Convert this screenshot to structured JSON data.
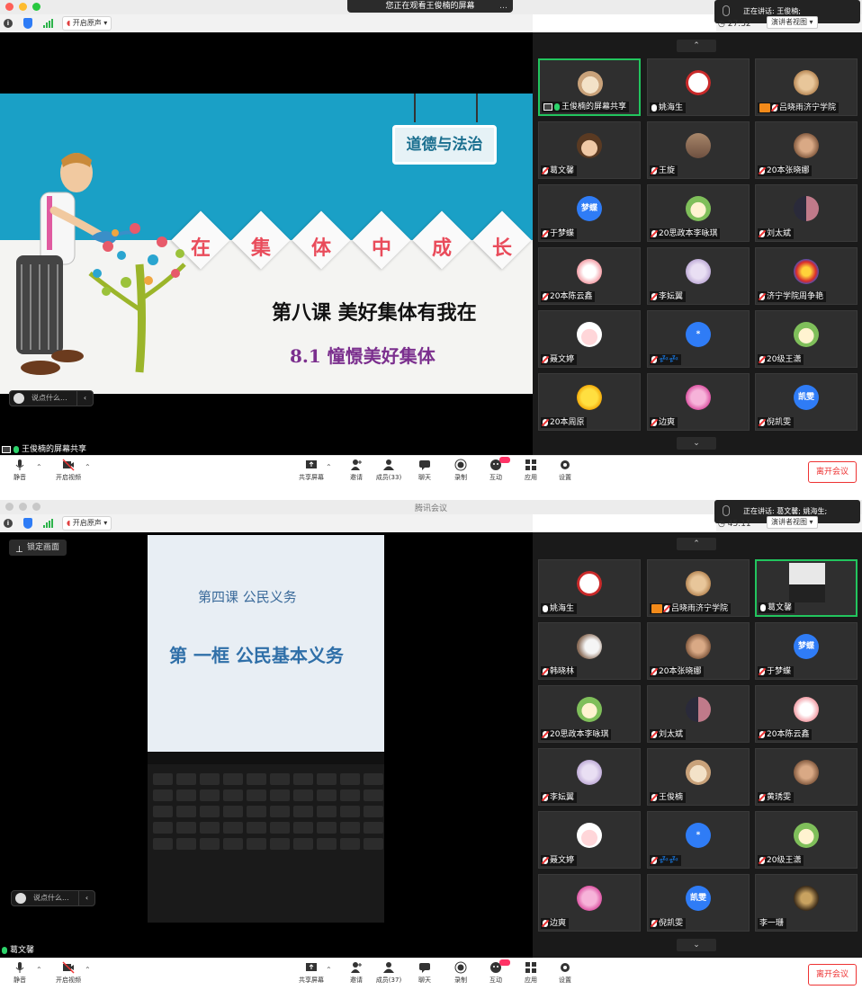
{
  "windowA": {
    "banner": "您正在观看王俊楠的屏幕",
    "original_sound": "开启原声",
    "speaking": "正在讲话: 王俊楠;",
    "timer": "27:32",
    "view_label": "演讲者视图",
    "comment_placeholder": "说点什么...",
    "share_label": "王俊楠的屏幕共享",
    "slide": {
      "tag": "道德与法治",
      "title_chars": [
        "在",
        "集",
        "体",
        "中",
        "成",
        "长"
      ],
      "lesson": "第八课  美好集体有我在",
      "section": "8.1  憧憬美好集体"
    },
    "participants": [
      {
        "name": "王俊楠的屏幕共享",
        "avatar": "dog",
        "active": true
      },
      {
        "name": "姚海生",
        "avatar": "seal"
      },
      {
        "name": "吕晓雨济宁学院",
        "avatar": "cat",
        "host": true
      },
      {
        "name": "葛文馨",
        "avatar": "child"
      },
      {
        "name": "王旋",
        "avatar": "photo"
      },
      {
        "name": "20本张晓娜",
        "avatar": "brown"
      },
      {
        "name": "于梦蝶",
        "avatar": "text",
        "text": "梦蝶",
        "color": "#2f7cf6"
      },
      {
        "name": "20思政本李咏琪",
        "avatar": "frog"
      },
      {
        "name": "刘太斌",
        "avatar": "couple"
      },
      {
        "name": "20本陈云鑫",
        "avatar": "pink"
      },
      {
        "name": "李妘翼",
        "avatar": "lav"
      },
      {
        "name": "济宁学院周争艳",
        "avatar": "mario"
      },
      {
        "name": "聂文婷",
        "avatar": "pig"
      },
      {
        "name": "💤💤",
        "avatar": "text",
        "text": "*",
        "color": "#2f7cf6"
      },
      {
        "name": "20级王潇",
        "avatar": "frog"
      },
      {
        "name": "20本周原",
        "avatar": "sun"
      },
      {
        "name": "边爽",
        "avatar": "pony"
      },
      {
        "name": "倪凯雯",
        "avatar": "text",
        "text": "凯雯",
        "color": "#2f7cf6"
      }
    ],
    "participants_count": "成员(33)"
  },
  "windowB": {
    "title": "腾讯会议",
    "original_sound": "开启原声",
    "speaking": "正在讲话: 葛文馨; 姚海生;",
    "timer": "45:11",
    "view_label": "演讲者视图",
    "lock_label": "锁定画面",
    "comment_placeholder": "说点什么...",
    "share_label": "葛文馨",
    "photo": {
      "line1": "第四课    公民义务",
      "line2": "第 一框  公民基本义务"
    },
    "participants": [
      {
        "name": "姚海生",
        "avatar": "seal"
      },
      {
        "name": "吕晓雨济宁学院",
        "avatar": "cat",
        "host": true
      },
      {
        "name": "葛文馨",
        "avatar": "doc",
        "active": true
      },
      {
        "name": "韩晓林",
        "avatar": "white"
      },
      {
        "name": "20本张晓娜",
        "avatar": "brown"
      },
      {
        "name": "于梦蝶",
        "avatar": "text",
        "text": "梦蝶",
        "color": "#2f7cf6"
      },
      {
        "name": "20思政本李咏琪",
        "avatar": "frog"
      },
      {
        "name": "刘太斌",
        "avatar": "couple"
      },
      {
        "name": "20本陈云鑫",
        "avatar": "pink"
      },
      {
        "name": "李妘翼",
        "avatar": "lav"
      },
      {
        "name": "王俊楠",
        "avatar": "dog"
      },
      {
        "name": "黄琇雯",
        "avatar": "brown"
      },
      {
        "name": "聂文婷",
        "avatar": "pig"
      },
      {
        "name": "💤💤",
        "avatar": "text",
        "text": "*",
        "color": "#2f7cf6"
      },
      {
        "name": "20级王潇",
        "avatar": "frog"
      },
      {
        "name": "边爽",
        "avatar": "pony"
      },
      {
        "name": "倪凯雯",
        "avatar": "text",
        "text": "凯雯",
        "color": "#2f7cf6"
      },
      {
        "name": "李一珊",
        "avatar": "car",
        "nomic": true
      }
    ],
    "participants_count": "成员(37)"
  },
  "toolbar": {
    "mute": "静音",
    "video": "开启视频",
    "share": "共享屏幕",
    "invite": "邀请",
    "chat": "聊天",
    "record": "录制",
    "interact": "互动",
    "apps": "应用",
    "settings": "设置",
    "leave": "离开会议"
  },
  "colors": {
    "leave": "#e33333",
    "active_border": "#22c55e",
    "accent": "#2f7cf6"
  }
}
